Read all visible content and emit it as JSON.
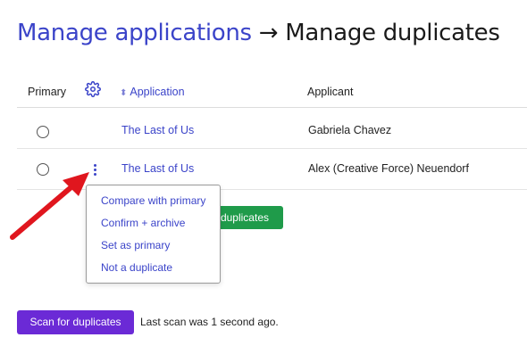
{
  "header": {
    "breadcrumb_parent": "Manage applications",
    "separator": "→",
    "current_page": "Manage duplicates"
  },
  "table": {
    "columns": {
      "primary": "Primary",
      "settings_icon": "gear-icon",
      "application": "Application",
      "application_sort_icon": "sort-icon",
      "applicant": "Applicant"
    },
    "rows": [
      {
        "application": "The Last of Us",
        "applicant": "Gabriela Chavez"
      },
      {
        "application": "The Last of Us",
        "applicant": "Alex (Creative Force) Neuendorf"
      }
    ]
  },
  "context_menu": {
    "items": [
      "Compare with primary",
      "Confirm + archive",
      "Set as primary",
      "Not a duplicate"
    ]
  },
  "partial_button_label": "duplicates",
  "footer": {
    "scan_button": "Scan for duplicates",
    "last_scan": "Last scan was 1 second ago."
  },
  "colors": {
    "link": "#3b44c9",
    "green_button": "#1f9b4a",
    "scan_button": "#6b2ad6",
    "annotation_arrow": "#e0161e"
  }
}
